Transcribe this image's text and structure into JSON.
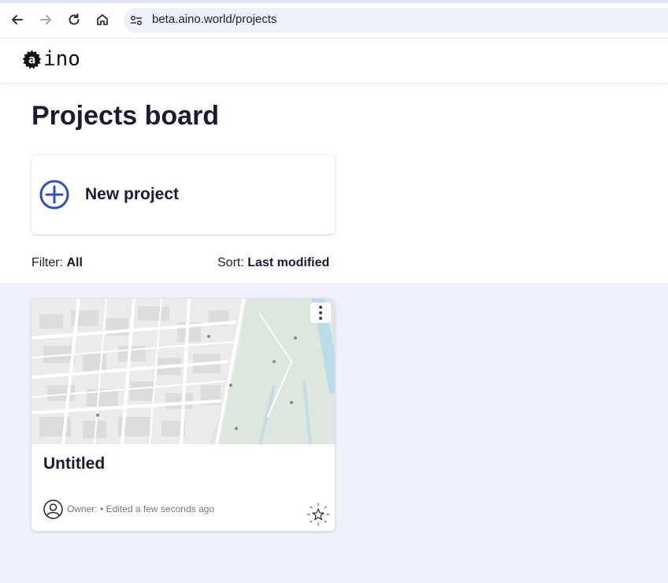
{
  "browser": {
    "url": "beta.aino.world/projects",
    "icons": [
      "back-arrow-icon",
      "forward-arrow-icon",
      "reload-icon",
      "home-icon",
      "site-settings-icon"
    ]
  },
  "header": {
    "logo_text": "ino",
    "logo_badge_letter": "a"
  },
  "page": {
    "title": "Projects board"
  },
  "new_project": {
    "label": "New project",
    "icon": "plus-circle-icon",
    "accent": "#2e4fc9"
  },
  "filter": {
    "label": "Filter:",
    "value": "All"
  },
  "sort": {
    "label": "Sort:",
    "value": "Last modified"
  },
  "projects": [
    {
      "title": "Untitled",
      "meta": "Owner: • Edited a few seconds ago",
      "icons": [
        "map-thumbnail",
        "more-vertical-icon",
        "avatar-icon",
        "favorite-star-icon"
      ]
    }
  ],
  "colors": {
    "board_background": "#eff2fe",
    "title_text": "#1b1b36"
  }
}
